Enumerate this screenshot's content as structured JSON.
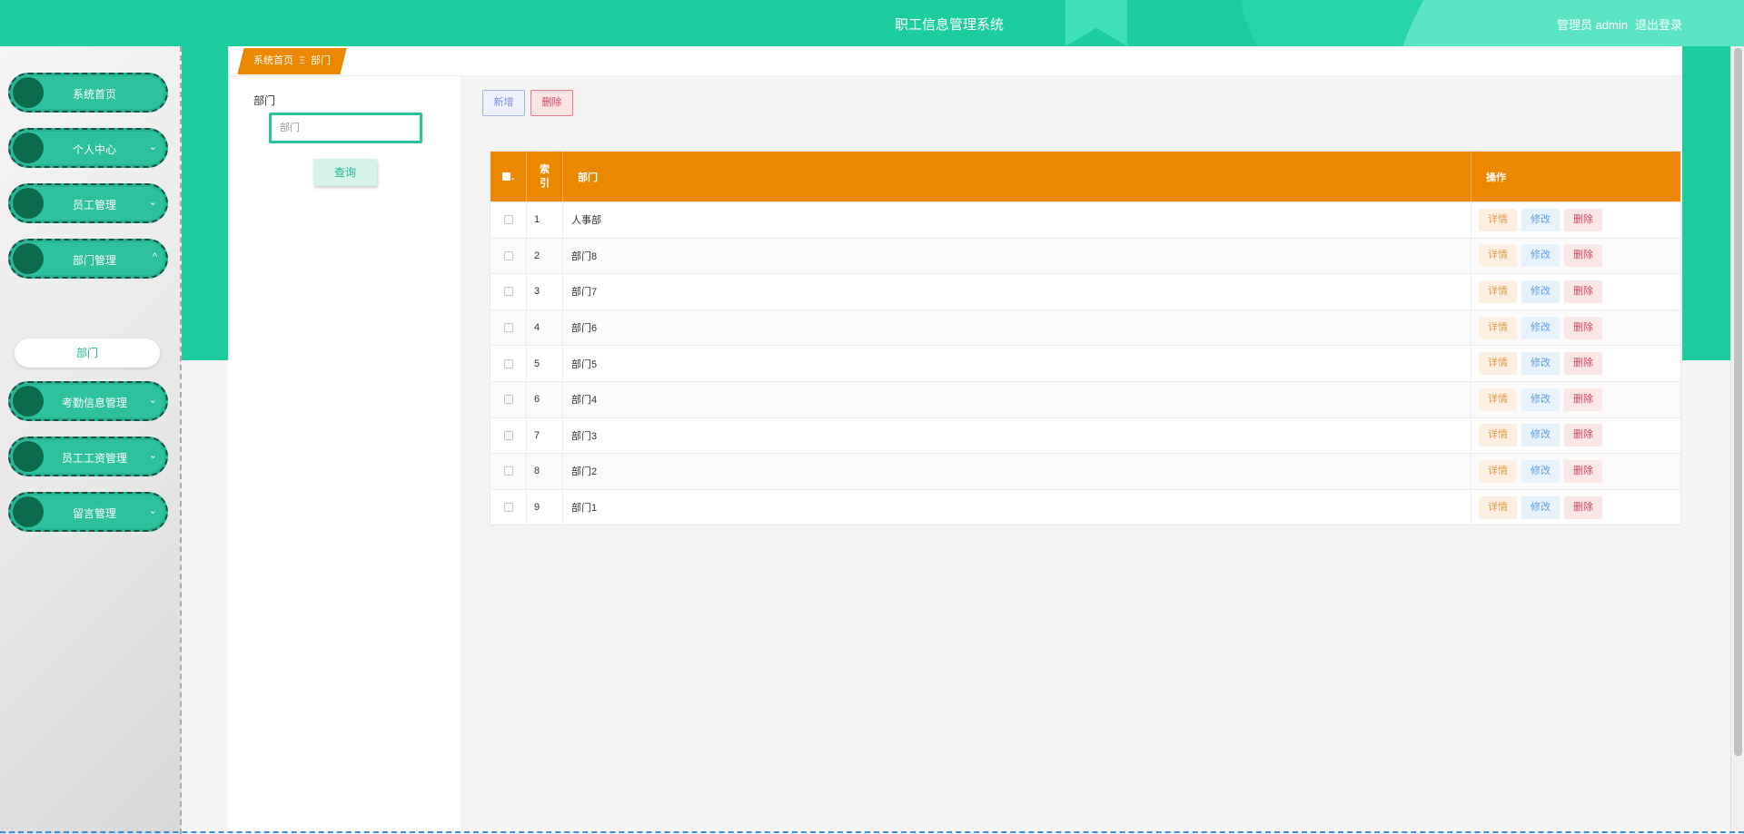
{
  "header": {
    "title": "职工信息管理系统",
    "user": "管理员 admin",
    "logout": "退出登录"
  },
  "sidebar": {
    "items": [
      {
        "label": "系统首页",
        "arrow": ""
      },
      {
        "label": "个人中心",
        "arrow": "⌄"
      },
      {
        "label": "员工管理",
        "arrow": "⌄"
      },
      {
        "label": "部门管理",
        "arrow": "^"
      },
      {
        "label": "考勤信息管理",
        "arrow": "⌄"
      },
      {
        "label": "员工工资管理",
        "arrow": "⌄"
      },
      {
        "label": "留言管理",
        "arrow": "⌄"
      }
    ],
    "sub_item": "部门"
  },
  "breadcrumb": {
    "home": "系统首页",
    "separator": "Ξ",
    "current": "部门"
  },
  "search": {
    "label": "部门",
    "placeholder": "部门",
    "query_button": "查询"
  },
  "toolbar": {
    "add_label": "新增",
    "delete_label": "删除"
  },
  "table": {
    "headers": {
      "index": "索引",
      "name": "部门",
      "ops": "操作"
    },
    "rows": [
      {
        "index": "1",
        "name": "人事部"
      },
      {
        "index": "2",
        "name": "部门8"
      },
      {
        "index": "3",
        "name": "部门7"
      },
      {
        "index": "4",
        "name": "部门6"
      },
      {
        "index": "5",
        "name": "部门5"
      },
      {
        "index": "6",
        "name": "部门4"
      },
      {
        "index": "7",
        "name": "部门3"
      },
      {
        "index": "8",
        "name": "部门2"
      },
      {
        "index": "9",
        "name": "部门1"
      }
    ],
    "op_labels": {
      "detail": "详情",
      "edit": "修改",
      "delete": "删除"
    }
  },
  "colors": {
    "primary_green": "#1ccda0",
    "table_header_orange": "#ec8700"
  }
}
